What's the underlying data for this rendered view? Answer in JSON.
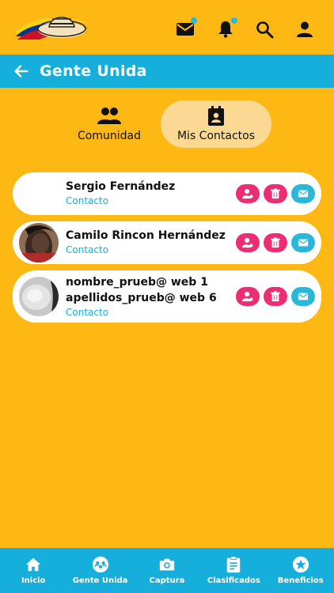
{
  "app": {
    "brand_colors": {
      "yellow": "#FDB813",
      "blue": "#16AEDB",
      "pink": "#EC2D74",
      "light_blue": "#2BB7DA"
    }
  },
  "topbar": {
    "icons": [
      "logo-sombrero",
      "mail-icon",
      "bell-icon",
      "search-icon",
      "user-icon"
    ]
  },
  "header": {
    "title": "Gente Unida",
    "back_icon": "arrow-left-icon"
  },
  "tabs": [
    {
      "label": "Comunidad",
      "icon": "group-icon",
      "active": false
    },
    {
      "label": "Mis Contactos",
      "icon": "contacts-icon",
      "active": true
    }
  ],
  "contacts": [
    {
      "name_line1": "Sergio Fernández",
      "name_line2": "",
      "subtitle": "Contacto",
      "avatar": "none"
    },
    {
      "name_line1": "Camilo Rincon Hernández",
      "name_line2": "",
      "subtitle": "Contacto",
      "avatar": "photo"
    },
    {
      "name_line1": "nombre_prueb@ web 1",
      "name_line2": "apellidos_prueb@ web 6",
      "subtitle": "Contacto",
      "avatar": "photo"
    }
  ],
  "contact_actions": [
    "profile-icon",
    "trash-icon",
    "mail-icon"
  ],
  "bottomnav": [
    {
      "label": "Inicio",
      "icon": "home-icon"
    },
    {
      "label": "Gente Unida",
      "icon": "people-icon"
    },
    {
      "label": "Captura",
      "icon": "camera-icon"
    },
    {
      "label": "Clasificados",
      "icon": "clipboard-icon"
    },
    {
      "label": "Beneficios",
      "icon": "star-icon"
    }
  ]
}
